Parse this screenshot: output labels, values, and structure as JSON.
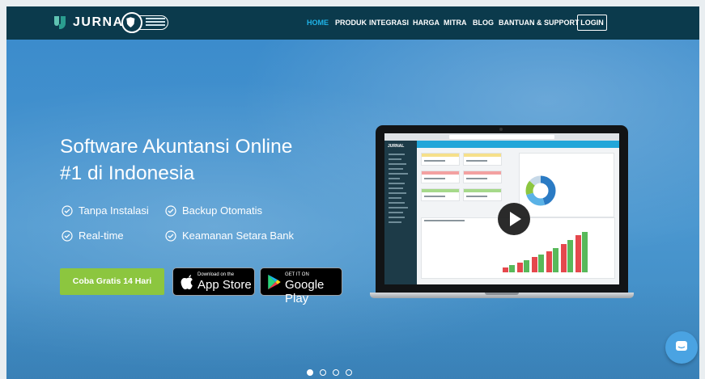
{
  "nav": {
    "brand": "JURNAL",
    "iso_badge": "ISO 27001",
    "menu": [
      "HOME",
      "PRODUK",
      "INTEGRASI",
      "HARGA",
      "MITRA",
      "BLOG",
      "BANTUAN & SUPPORT"
    ],
    "active_item": "HOME",
    "login": "LOGIN"
  },
  "hero": {
    "headline_line1": "Software Akuntansi Online",
    "headline_line2": "#1 di Indonesia",
    "features": [
      "Tanpa Instalasi",
      "Backup Otomatis",
      "Real-time",
      "Keamanan Setara Bank"
    ],
    "cta": "Coba Gratis 14 Hari",
    "appstore_small": "Download on the",
    "appstore_big": "App Store",
    "googleplay_small": "GET IT ON",
    "googleplay_big": "Google Play"
  },
  "video": {
    "app_brand": "JURNAL",
    "play_icon": "play-icon"
  },
  "carousel": {
    "slides": 4,
    "active": 1
  },
  "colors": {
    "nav_bg": "#0b3a4c",
    "active": "#1fb4e8",
    "cta_green": "#8cc63f",
    "hero_blue": "#3f8fc6",
    "chat_blue": "#4aa3e2"
  }
}
